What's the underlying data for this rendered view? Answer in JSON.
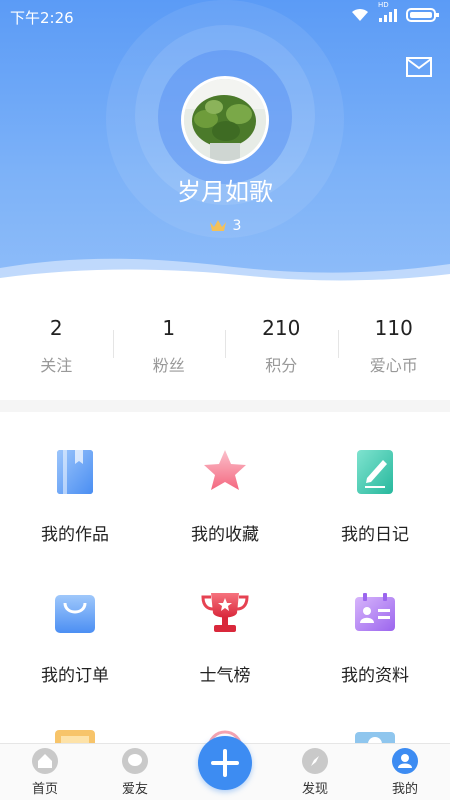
{
  "status_bar": {
    "time": "下午2:26",
    "network_label": "HD"
  },
  "profile": {
    "username": "岁月如歌",
    "level": "3"
  },
  "stats": [
    {
      "value": "2",
      "label": "关注"
    },
    {
      "value": "1",
      "label": "粉丝"
    },
    {
      "value": "210",
      "label": "积分"
    },
    {
      "value": "110",
      "label": "爱心币"
    }
  ],
  "menu": [
    {
      "label": "我的作品",
      "icon": "book-icon"
    },
    {
      "label": "我的收藏",
      "icon": "star-icon"
    },
    {
      "label": "我的日记",
      "icon": "diary-icon"
    },
    {
      "label": "我的订单",
      "icon": "bag-icon"
    },
    {
      "label": "士气榜",
      "icon": "trophy-icon"
    },
    {
      "label": "我的资料",
      "icon": "profile-card-icon"
    }
  ],
  "tabbar": [
    {
      "label": "首页",
      "icon": "home-icon"
    },
    {
      "label": "爱友",
      "icon": "chat-icon"
    },
    {
      "label": "发现",
      "icon": "compass-icon"
    },
    {
      "label": "我的",
      "icon": "user-icon",
      "active": true
    }
  ],
  "colors": {
    "primary": "#3d8cf2",
    "header": "#6aa6f7"
  }
}
